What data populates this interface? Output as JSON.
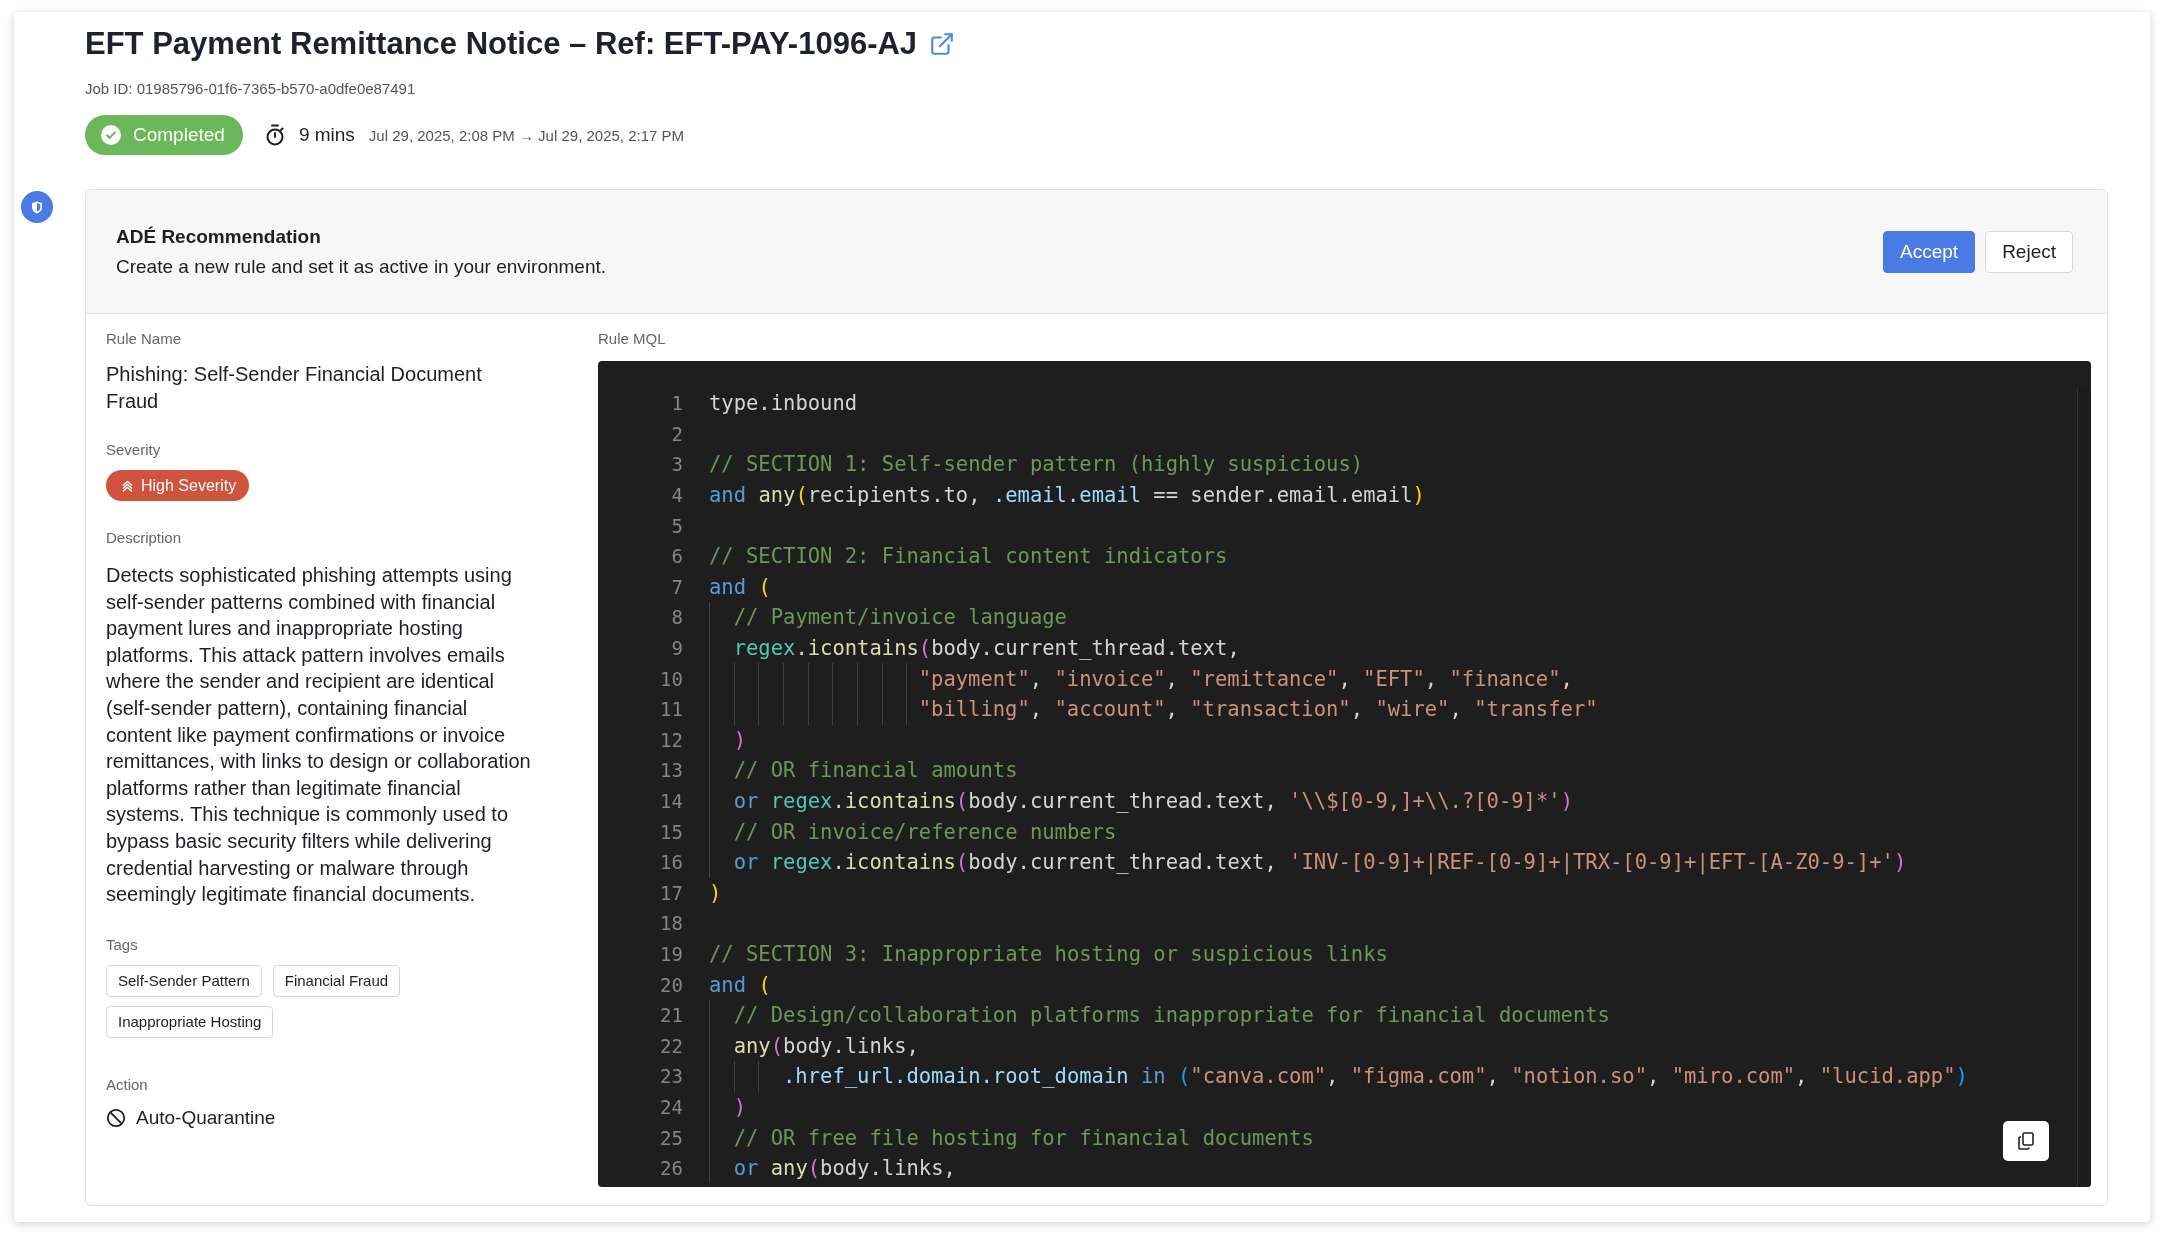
{
  "header": {
    "title": "EFT Payment Remittance Notice – Ref: EFT-PAY-1096-AJ",
    "job_id": "Job ID: 01985796-01f6-7365-b570-a0dfe0e87491",
    "status": "Completed",
    "duration": "9 mins",
    "time_range": "Jul 29, 2025, 2:08 PM → Jul 29, 2025, 2:17 PM"
  },
  "recommendation": {
    "title": "ADÉ Recommendation",
    "message": "Create a new rule and set it as active in your environment.",
    "buttons": [
      {
        "label": "Accept",
        "kind": "primary"
      },
      {
        "label": "Reject",
        "kind": "secondary"
      }
    ]
  },
  "rule": {
    "name_label": "Rule Name",
    "name": "Phishing: Self-Sender Financial Document Fraud",
    "severity_label": "Severity",
    "severity": "High Severity",
    "description_label": "Description",
    "description": "Detects sophisticated phishing attempts using self-sender patterns combined with financial payment lures and inappropriate hosting platforms. This attack pattern involves emails where the sender and recipient are identical (self-sender pattern), containing financial content like payment confirmations or invoice remittances, with links to design or collaboration platforms rather than legitimate financial systems. This technique is commonly used to bypass basic security filters while delivering credential harvesting or malware through seemingly legitimate financial documents.",
    "tags_label": "Tags",
    "tags": [
      "Self-Sender Pattern",
      "Financial Fraud",
      "Inappropriate Hosting"
    ],
    "action_label": "Action",
    "action": "Auto-Quarantine"
  },
  "code": {
    "label": "Rule MQL",
    "lines": [
      {
        "number": "1",
        "tokens": [
          {
            "kind": "plain",
            "text": "type.inbound"
          }
        ]
      },
      {
        "number": "2"
      },
      {
        "number": "3",
        "tokens": [
          {
            "kind": "comment",
            "text": "// SECTION 1: Self-sender pattern (highly suspicious)"
          }
        ]
      },
      {
        "number": "4",
        "tokens": [
          {
            "kind": "keyword",
            "text": "and "
          },
          {
            "kind": "function",
            "text": "any"
          },
          {
            "kind": "paren1",
            "text": "("
          },
          {
            "kind": "plain",
            "text": "recipients.to, "
          },
          {
            "kind": "property",
            "text": ".email.email"
          },
          {
            "kind": "plain",
            "text": " == sender.email.email"
          },
          {
            "kind": "paren1",
            "text": ")"
          }
        ]
      },
      {
        "number": "5"
      },
      {
        "number": "6",
        "tokens": [
          {
            "kind": "comment",
            "text": "// SECTION 2: Financial content indicators"
          }
        ]
      },
      {
        "number": "7",
        "tokens": [
          {
            "kind": "keyword",
            "text": "and "
          },
          {
            "kind": "paren1",
            "text": "("
          }
        ]
      },
      {
        "number": "8",
        "tokens": [
          {
            "kind": "comment",
            "text": "  // Payment/invoice language"
          }
        ]
      },
      {
        "number": "9",
        "tokens": [
          {
            "kind": "namespace",
            "text": "  regex"
          },
          {
            "kind": "plain",
            "text": "."
          },
          {
            "kind": "function",
            "text": "icontains"
          },
          {
            "kind": "paren2",
            "text": "("
          },
          {
            "kind": "plain",
            "text": "body.current_thread.text,"
          }
        ]
      },
      {
        "number": "10",
        "tokens": [
          {
            "kind": "string",
            "text": "                 \"payment\""
          },
          {
            "kind": "plain",
            "text": ", "
          },
          {
            "kind": "string",
            "text": "\"invoice\""
          },
          {
            "kind": "plain",
            "text": ", "
          },
          {
            "kind": "string",
            "text": "\"remittance\""
          },
          {
            "kind": "plain",
            "text": ", "
          },
          {
            "kind": "string",
            "text": "\"EFT\""
          },
          {
            "kind": "plain",
            "text": ", "
          },
          {
            "kind": "string",
            "text": "\"finance\""
          },
          {
            "kind": "plain",
            "text": ","
          }
        ]
      },
      {
        "number": "11",
        "tokens": [
          {
            "kind": "string",
            "text": "                 \"billing\""
          },
          {
            "kind": "plain",
            "text": ", "
          },
          {
            "kind": "string",
            "text": "\"account\""
          },
          {
            "kind": "plain",
            "text": ", "
          },
          {
            "kind": "string",
            "text": "\"transaction\""
          },
          {
            "kind": "plain",
            "text": ", "
          },
          {
            "kind": "string",
            "text": "\"wire\""
          },
          {
            "kind": "plain",
            "text": ", "
          },
          {
            "kind": "string",
            "text": "\"transfer\""
          }
        ]
      },
      {
        "number": "12",
        "tokens": [
          {
            "kind": "paren2",
            "text": "  )"
          }
        ]
      },
      {
        "number": "13",
        "tokens": [
          {
            "kind": "comment",
            "text": "  // OR financial amounts"
          }
        ]
      },
      {
        "number": "14",
        "tokens": [
          {
            "kind": "keyword",
            "text": "  or "
          },
          {
            "kind": "namespace",
            "text": "regex"
          },
          {
            "kind": "plain",
            "text": "."
          },
          {
            "kind": "function",
            "text": "icontains"
          },
          {
            "kind": "paren2",
            "text": "("
          },
          {
            "kind": "plain",
            "text": "body.current_thread.text, "
          },
          {
            "kind": "string",
            "text": "'\\\\$[0-9,]+\\\\.?[0-9]*'"
          },
          {
            "kind": "paren2",
            "text": ")"
          }
        ]
      },
      {
        "number": "15",
        "tokens": [
          {
            "kind": "comment",
            "text": "  // OR invoice/reference numbers"
          }
        ]
      },
      {
        "number": "16",
        "tokens": [
          {
            "kind": "keyword",
            "text": "  or "
          },
          {
            "kind": "namespace",
            "text": "regex"
          },
          {
            "kind": "plain",
            "text": "."
          },
          {
            "kind": "function",
            "text": "icontains"
          },
          {
            "kind": "paren2",
            "text": "("
          },
          {
            "kind": "plain",
            "text": "body.current_thread.text, "
          },
          {
            "kind": "string",
            "text": "'INV-[0-9]+|REF-[0-9]+|TRX-[0-9]+|EFT-[A-Z0-9-]+'"
          },
          {
            "kind": "paren2",
            "text": ")"
          }
        ]
      },
      {
        "number": "17",
        "tokens": [
          {
            "kind": "paren1",
            "text": ")"
          }
        ]
      },
      {
        "number": "18"
      },
      {
        "number": "19",
        "tokens": [
          {
            "kind": "comment",
            "text": "// SECTION 3: Inappropriate hosting or suspicious links"
          }
        ]
      },
      {
        "number": "20",
        "tokens": [
          {
            "kind": "keyword",
            "text": "and "
          },
          {
            "kind": "paren1",
            "text": "("
          }
        ]
      },
      {
        "number": "21",
        "tokens": [
          {
            "kind": "comment",
            "text": "  // Design/collaboration platforms inappropriate for financial documents"
          }
        ]
      },
      {
        "number": "22",
        "tokens": [
          {
            "kind": "function",
            "text": "  any"
          },
          {
            "kind": "paren2",
            "text": "("
          },
          {
            "kind": "plain",
            "text": "body.links,"
          }
        ]
      },
      {
        "number": "23",
        "tokens": [
          {
            "kind": "property",
            "text": "      .href_url.domain.root_domain"
          },
          {
            "kind": "keyword",
            "text": " in "
          },
          {
            "kind": "paren3",
            "text": "("
          },
          {
            "kind": "string",
            "text": "\"canva.com\""
          },
          {
            "kind": "plain",
            "text": ", "
          },
          {
            "kind": "string",
            "text": "\"figma.com\""
          },
          {
            "kind": "plain",
            "text": ", "
          },
          {
            "kind": "string",
            "text": "\"notion.so\""
          },
          {
            "kind": "plain",
            "text": ", "
          },
          {
            "kind": "string",
            "text": "\"miro.com\""
          },
          {
            "kind": "plain",
            "text": ", "
          },
          {
            "kind": "string",
            "text": "\"lucid.app\""
          },
          {
            "kind": "paren3",
            "text": ")"
          }
        ]
      },
      {
        "number": "24",
        "tokens": [
          {
            "kind": "paren2",
            "text": "  )"
          }
        ]
      },
      {
        "number": "25",
        "tokens": [
          {
            "kind": "comment",
            "text": "  // OR free file hosting for financial documents"
          }
        ]
      },
      {
        "number": "26",
        "tokens": [
          {
            "kind": "keyword",
            "text": "  or "
          },
          {
            "kind": "function",
            "text": "any"
          },
          {
            "kind": "paren2",
            "text": "("
          },
          {
            "kind": "plain",
            "text": "body.links,"
          }
        ]
      }
    ]
  }
}
